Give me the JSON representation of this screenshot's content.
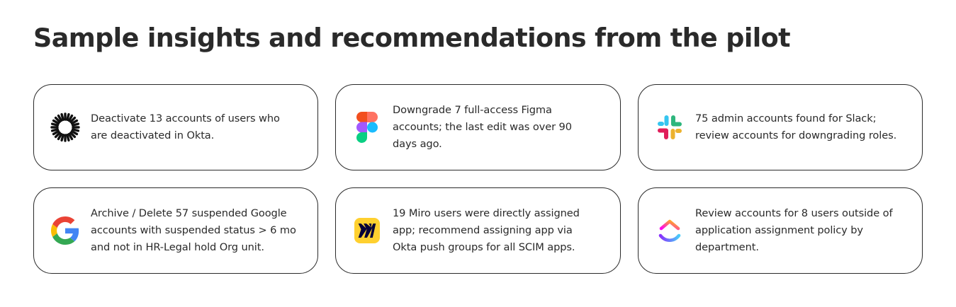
{
  "page": {
    "title": "Sample insights and recommendations from the pilot"
  },
  "cards": [
    {
      "icon": "okta-sunburst-icon",
      "text": "Deactivate 13 accounts of users who are deactivated in Okta."
    },
    {
      "icon": "figma-icon",
      "text": "Downgrade 7 full-access Figma accounts; the last edit was over 90 days ago."
    },
    {
      "icon": "slack-icon",
      "text": "75 admin accounts found for Slack; review accounts for downgrading roles."
    },
    {
      "icon": "google-icon",
      "text": "Archive / Delete 57 suspended Google accounts with suspended status > 6 mo and not in HR-Legal hold Org unit."
    },
    {
      "icon": "miro-icon",
      "text": "19 Miro users were directly assigned app; recommend assigning app via Okta push groups for all SCIM apps."
    },
    {
      "icon": "clickup-icon",
      "text": "Review accounts for 8 users outside of application assignment policy by department."
    }
  ],
  "colors": {
    "card_border": "#2a2a2a",
    "text": "#2a2a2a",
    "figma_red": "#F24E1E",
    "figma_orange": "#FF7262",
    "figma_purple": "#A259FF",
    "figma_blue": "#1ABCFE",
    "figma_green": "#0ACF83",
    "slack_blue": "#36C5F0",
    "slack_green": "#2EB67D",
    "slack_yellow": "#ECB22E",
    "slack_red": "#E01E5A",
    "google_blue": "#4285F4",
    "google_green": "#34A853",
    "google_yellow": "#FBBC05",
    "google_red": "#EA4335",
    "miro_yellow": "#FFD02F",
    "miro_dark": "#050038"
  }
}
